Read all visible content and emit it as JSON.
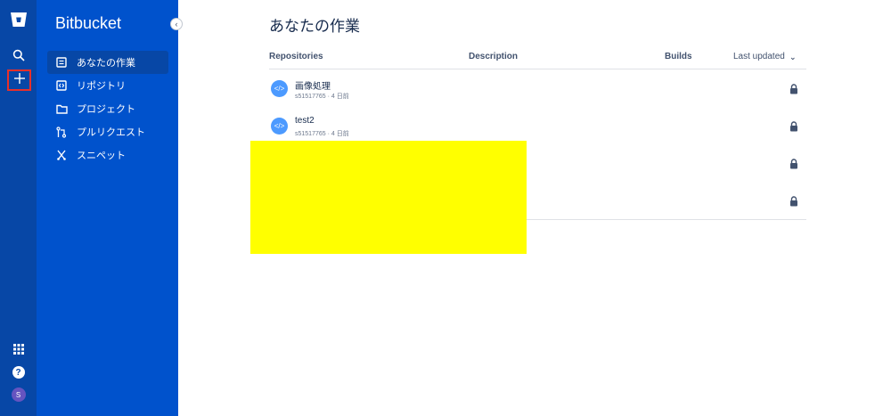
{
  "rail": {
    "icons": [
      "bitbucket-logo-icon",
      "search-icon",
      "plus-icon",
      "app-switcher-icon",
      "help-icon",
      "avatar"
    ],
    "avatar_initial": "S",
    "help_label": "?"
  },
  "sidebar": {
    "brand": "Bitbucket",
    "collapse_glyph": "‹",
    "items": [
      {
        "label": "あなたの作業",
        "icon": "document-icon",
        "active": true
      },
      {
        "label": "リポジトリ",
        "icon": "code-icon",
        "active": false
      },
      {
        "label": "プロジェクト",
        "icon": "folder-icon",
        "active": false
      },
      {
        "label": "プルリクエスト",
        "icon": "pull-request-icon",
        "active": false
      },
      {
        "label": "スニペット",
        "icon": "scissors-icon",
        "active": false
      }
    ]
  },
  "main": {
    "title": "あなたの作業",
    "columns": {
      "repositories": "Repositories",
      "description": "Description",
      "builds": "Builds",
      "last_updated": "Last updated",
      "sort_glyph": "⌄"
    },
    "rows": [
      {
        "name": "画像処理",
        "meta": "s51517765 · 4 日前",
        "avatar": "</>"
      },
      {
        "name": "test2",
        "meta": "s51517765 · 4 日前",
        "avatar": "</>"
      },
      {
        "name": "",
        "meta": "",
        "avatar": ""
      },
      {
        "name": "",
        "meta": "",
        "avatar": ""
      }
    ]
  },
  "colors": {
    "rail": "#0747a6",
    "sidebar": "#0052cc",
    "accent": "#4c9aff",
    "redaction": "#ffff00",
    "highlight_border": "#e8302a"
  }
}
